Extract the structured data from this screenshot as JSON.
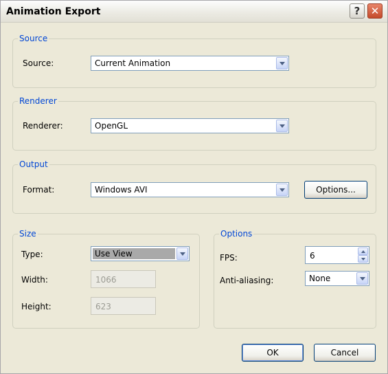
{
  "window": {
    "title": "Animation Export",
    "help_glyph": "?",
    "close_glyph": "✕"
  },
  "source_group": {
    "legend": "Source",
    "source_label": "Source:",
    "source_value": "Current Animation"
  },
  "renderer_group": {
    "legend": "Renderer",
    "renderer_label": "Renderer:",
    "renderer_value": "OpenGL"
  },
  "output_group": {
    "legend": "Output",
    "format_label": "Format:",
    "format_value": "Windows AVI",
    "options_button": "Options..."
  },
  "size_group": {
    "legend": "Size",
    "type_label": "Type:",
    "type_value": "Use View",
    "width_label": "Width:",
    "width_value": "1066",
    "height_label": "Height:",
    "height_value": "623"
  },
  "options_group": {
    "legend": "Options",
    "fps_label": "FPS:",
    "fps_value": "6",
    "antialias_label": "Anti-aliasing:",
    "antialias_value": "None"
  },
  "footer": {
    "ok": "OK",
    "cancel": "Cancel"
  },
  "icons": {
    "help": "question-icon",
    "close": "close-icon",
    "dropdown": "chevron-down-icon",
    "spin_up": "arrow-up-icon",
    "spin_down": "arrow-down-icon"
  },
  "colors": {
    "dialog_bg": "#ece9d8",
    "legend_text": "#0046d5",
    "close_button": "#c44a2a",
    "input_border": "#7f9db9"
  }
}
